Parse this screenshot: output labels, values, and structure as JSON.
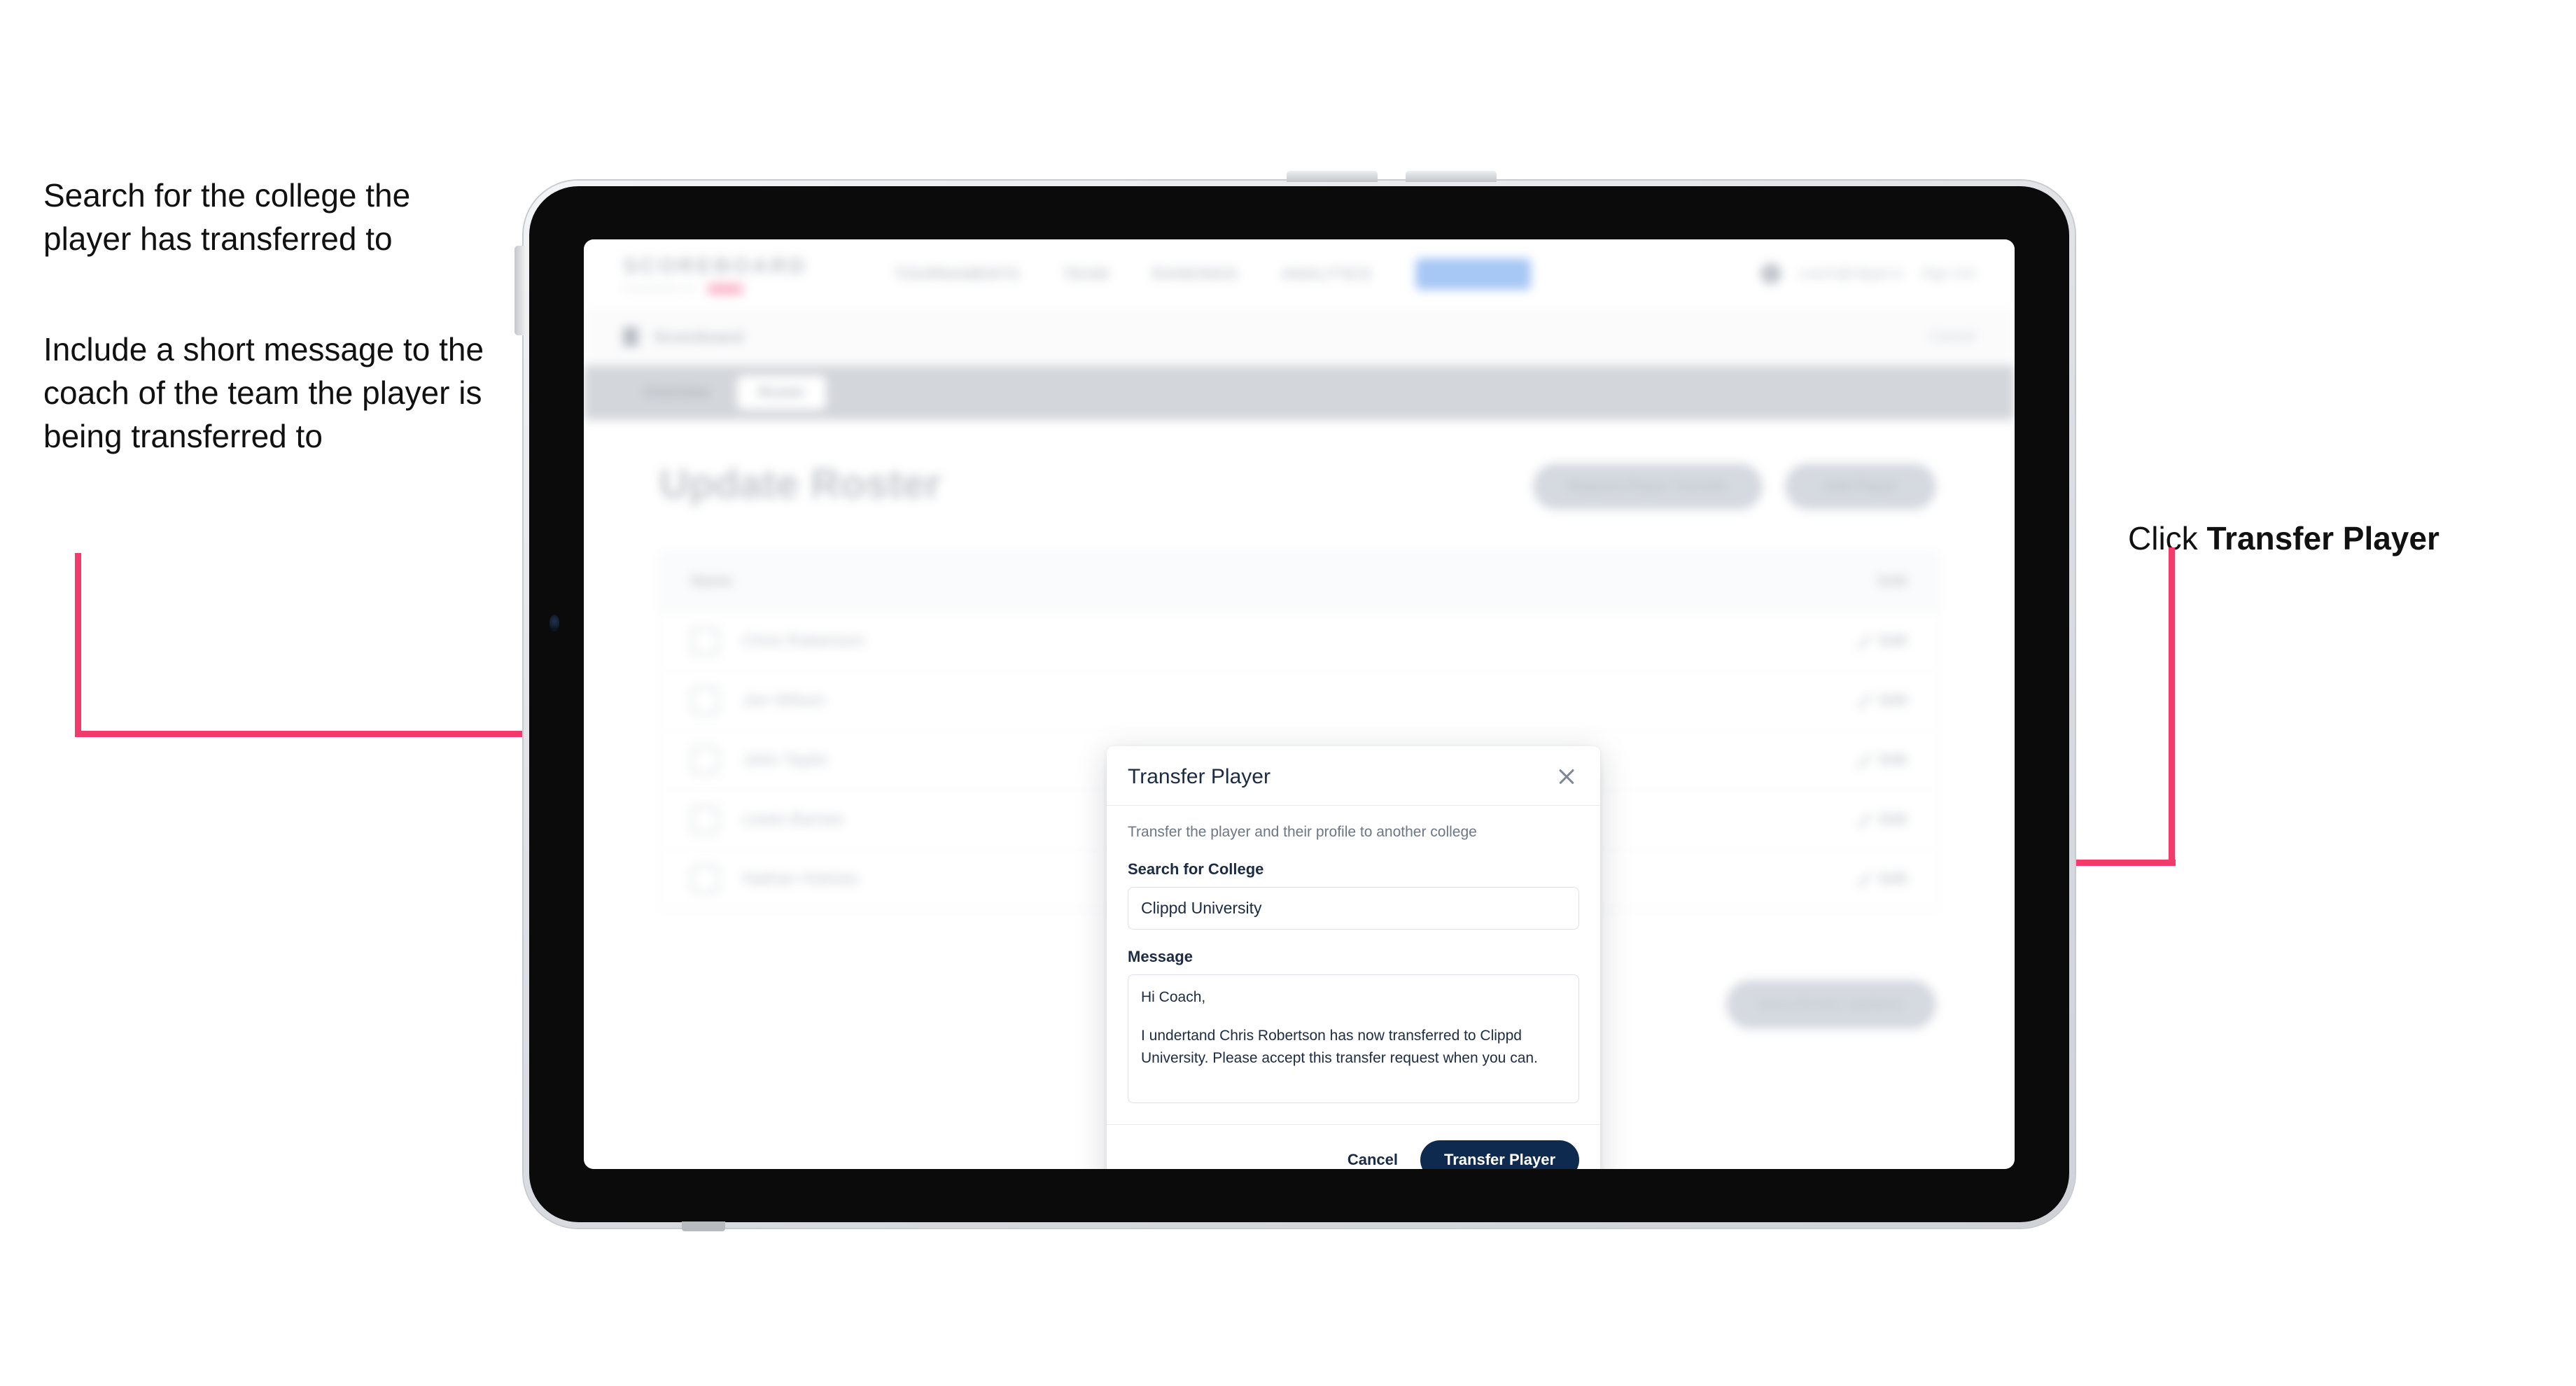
{
  "annotations": {
    "left_1": "Search for the college the player has transferred to",
    "left_2": "Include a short message to the coach of the team the player is being transferred to",
    "right_prefix": "Click ",
    "right_bold": "Transfer Player"
  },
  "colors": {
    "accent_pink": "#F23A6B",
    "primary_navy": "#0E2A4E",
    "text_dark": "#1C2B44",
    "muted_text": "#6C7685",
    "border": "#DDE0E6"
  },
  "app": {
    "logo": "SCOREBOARD",
    "logo_sub": "POWERED BY",
    "logo_badge": "NEW",
    "nav": [
      {
        "label": "TOURNAMENTS"
      },
      {
        "label": "TEAM"
      },
      {
        "label": "RANKINGS"
      },
      {
        "label": "ANALYTICS"
      }
    ],
    "nav_cta": "UPGRADE",
    "account": {
      "email": "coach@clippd.io",
      "sign_out": "Sign Out"
    },
    "breadcrumb": {
      "label": "Scoreboard",
      "sub": "Admin",
      "right": "Cancel"
    },
    "tabs": [
      {
        "label": "Overview",
        "active": false
      },
      {
        "label": "Roster",
        "active": true
      }
    ],
    "page_title": "Update Roster",
    "header_buttons": [
      {
        "label": "Request Player Transfer"
      },
      {
        "label": "Add Player"
      }
    ],
    "roster": {
      "columns": [
        "Name",
        "Edit"
      ],
      "rows": [
        {
          "name": "Chris Robertson",
          "action": "Edit"
        },
        {
          "name": "Jon Wilson",
          "action": "Edit"
        },
        {
          "name": "John Taylor",
          "action": "Edit"
        },
        {
          "name": "Lewis Barnes",
          "action": "Edit"
        },
        {
          "name": "Nathan Holmes",
          "action": "Edit"
        }
      ]
    },
    "save_button": "Save Roster Updates"
  },
  "modal": {
    "title": "Transfer Player",
    "close_icon": "close-icon",
    "subtitle": "Transfer the player and their profile to another college",
    "fields": {
      "college_label": "Search for College",
      "college_value": "Clippd University",
      "college_placeholder": "Search for College",
      "message_label": "Message",
      "message_line_1": "Hi Coach,",
      "message_line_2": "I undertand Chris Robertson has now transferred to Clippd University. Please accept this transfer request when you can."
    },
    "footer": {
      "cancel": "Cancel",
      "submit": "Transfer Player"
    }
  }
}
